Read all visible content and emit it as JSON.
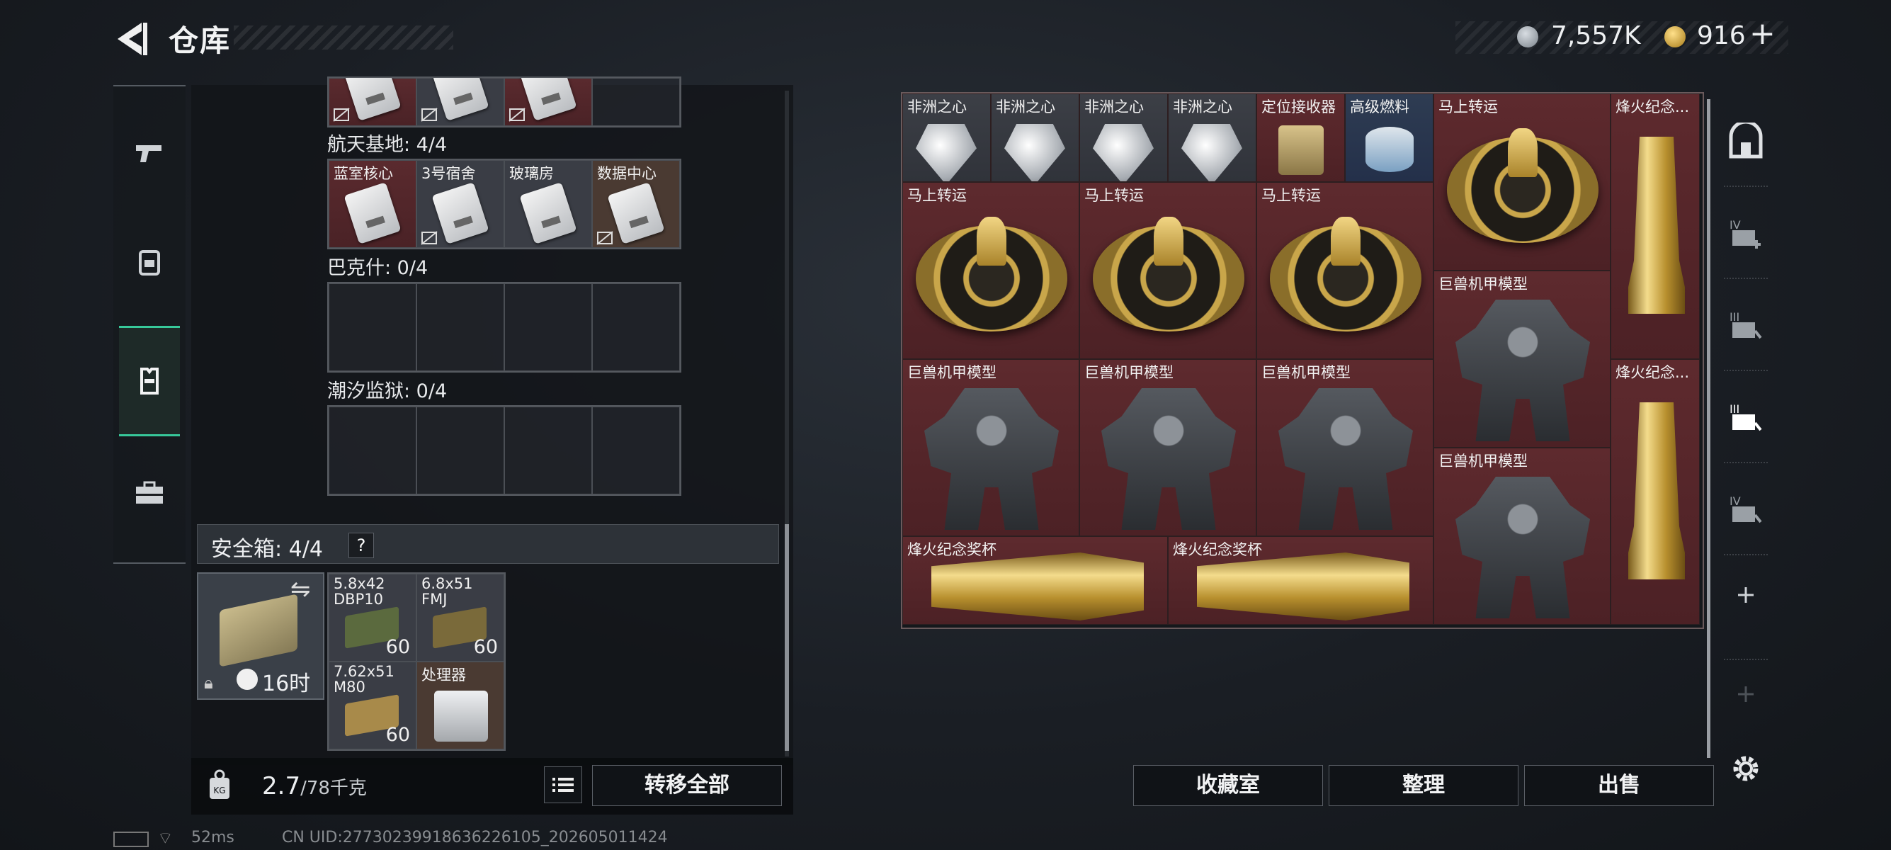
{
  "header": {
    "title": "仓库",
    "currency_primary": "7,557K",
    "currency_secondary": "916",
    "currency_secondary_add": "+"
  },
  "left_nav": {
    "items": [
      {
        "icon": "gun-icon"
      },
      {
        "icon": "backpack-icon"
      },
      {
        "icon": "vest-icon",
        "active": true
      },
      {
        "icon": "toolbox-icon"
      }
    ]
  },
  "storage": {
    "top_row_cards": [
      true,
      true,
      true
    ],
    "aerospace": {
      "title": "航天基地: 4/4",
      "slots": [
        "蓝室核心",
        "3号宿舍",
        "玻璃房",
        "数据中心"
      ]
    },
    "bakersh": {
      "title": "巴克什: 0/4"
    },
    "tide_prison": {
      "title": "潮汐监狱: 0/4"
    }
  },
  "safe_box": {
    "title": "安全箱: 4/4",
    "help": "?",
    "time": "16时",
    "items": [
      {
        "name": "5.8x42 DBP10",
        "count": "60",
        "color": "#5b6a3e"
      },
      {
        "name": "6.8x51 FMJ",
        "count": "60",
        "color": "#7a6a3a"
      },
      {
        "name": "7.62x51 M80",
        "count": "60",
        "color": "#a88a4a"
      },
      {
        "name": "处理器",
        "count": ""
      }
    ]
  },
  "bottom_left": {
    "weight_value": "2.7",
    "weight_max": "/78千克",
    "transfer_all": "转移全部"
  },
  "status": {
    "ping": "52ms",
    "uid": "CN UID:27730239918636226105_202605011424"
  },
  "vault": {
    "gems": [
      "非洲之心",
      "非洲之心",
      "非洲之心",
      "非洲之心"
    ],
    "receiver": "定位接收器",
    "fuel": "高级燃料",
    "luck_big": "马上转运",
    "trophy_top": "烽火纪念...",
    "luck_row": [
      "马上转运",
      "马上转运",
      "马上转运"
    ],
    "mech_big_1": "巨兽机甲模型",
    "mech_row": [
      "巨兽机甲模型",
      "巨兽机甲模型",
      "巨兽机甲模型"
    ],
    "trophy_mid": "烽火纪念...",
    "mech_big_2": "巨兽机甲模型",
    "trophy_cups": [
      "烽火纪念奖杯",
      "烽火纪念奖杯"
    ]
  },
  "bottom_right": {
    "collection": "收藏室",
    "sort": "整理",
    "sell": "出售"
  },
  "colors": {
    "accent_green": "#37c89a",
    "item_red": "#5e2a2e",
    "gold": "#c9a64a"
  }
}
